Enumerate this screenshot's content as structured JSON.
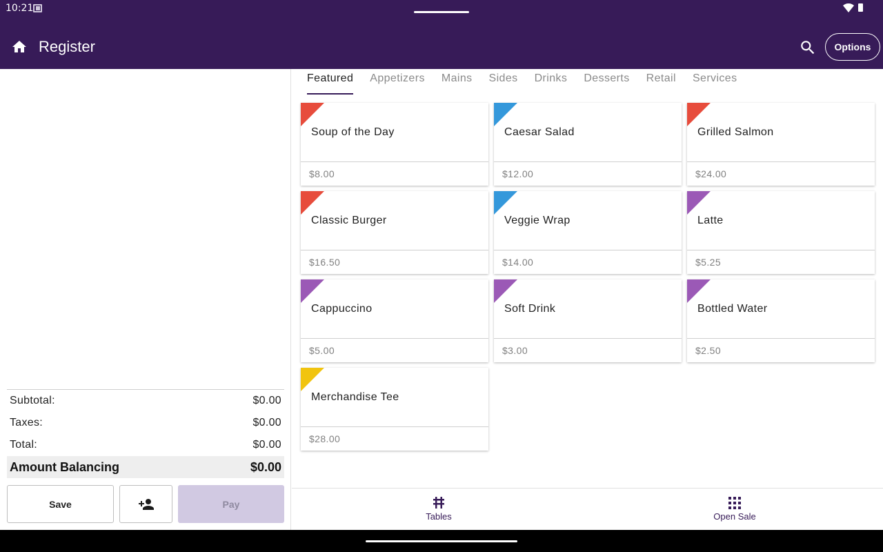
{
  "status": {
    "time": "10:21"
  },
  "header": {
    "title": "Register",
    "options_label": "Options",
    "search_icon": "search-icon",
    "home_icon": "home-icon"
  },
  "tabs": [
    {
      "label": "Featured",
      "active": true
    },
    {
      "label": "Appetizers",
      "active": false
    },
    {
      "label": "Mains",
      "active": false
    },
    {
      "label": "Sides",
      "active": false
    },
    {
      "label": "Drinks",
      "active": false
    },
    {
      "label": "Desserts",
      "active": false
    },
    {
      "label": "Retail",
      "active": false
    },
    {
      "label": "Services",
      "active": false
    }
  ],
  "items": [
    {
      "name": "Soup of the Day",
      "price": "$8.00",
      "color": "#e74c3c"
    },
    {
      "name": "Caesar Salad",
      "price": "$12.00",
      "color": "#3498db"
    },
    {
      "name": "Grilled Salmon",
      "price": "$24.00",
      "color": "#e74c3c"
    },
    {
      "name": "Classic Burger",
      "price": "$16.50",
      "color": "#e74c3c"
    },
    {
      "name": "Veggie Wrap",
      "price": "$14.00",
      "color": "#3498db"
    },
    {
      "name": "Latte",
      "price": "$5.25",
      "color": "#9b59b6"
    },
    {
      "name": "Cappuccino",
      "price": "$5.00",
      "color": "#9b59b6"
    },
    {
      "name": "Soft Drink",
      "price": "$3.00",
      "color": "#9b59b6"
    },
    {
      "name": "Bottled Water",
      "price": "$2.50",
      "color": "#9b59b6"
    },
    {
      "name": "Merchandise Tee",
      "price": "$28.00",
      "color": "#f1c40f"
    }
  ],
  "totals": {
    "subtotal_label": "Subtotal:",
    "subtotal_value": "$0.00",
    "taxes_label": "Taxes:",
    "taxes_value": "$0.00",
    "total_label": "Total:",
    "total_value": "$0.00",
    "balance_label": "Amount Balancing",
    "balance_value": "$0.00"
  },
  "actions": {
    "save_label": "Save",
    "pay_label": "Pay",
    "customer_icon": "add-customer-icon"
  },
  "bottom_nav": {
    "tables_label": "Tables",
    "tables_icon": "tables-icon",
    "open_sale_label": "Open Sale",
    "open_sale_icon": "grid-icon"
  },
  "colors": {
    "primary": "#371b58",
    "pay_disabled": "#d1c9e2"
  }
}
